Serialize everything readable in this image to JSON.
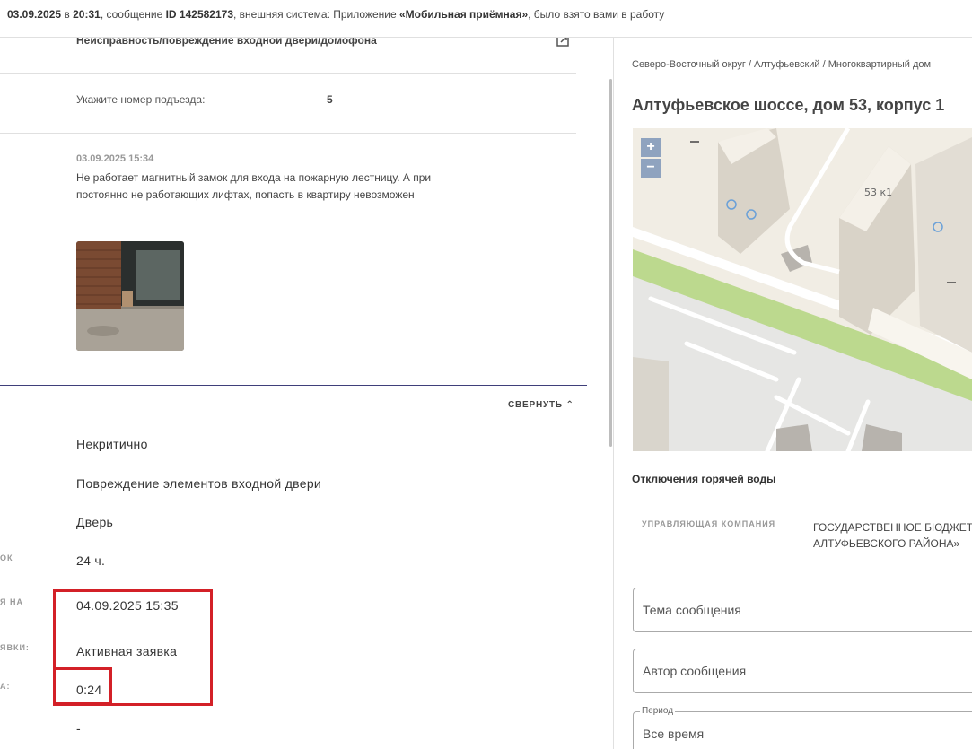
{
  "topbar": {
    "datetime_date": "03.09.2025",
    "in": " в ",
    "datetime_time": "20:31",
    "msg_prefix": ", сообщение ",
    "msg_id": "ID 142582173",
    "system_prefix": ", внешняя система: Приложение ",
    "system_name": "«Мобильная приёмная»",
    "suffix": ", было взято вами в работу"
  },
  "left": {
    "category_title": "Неисправность/повреждение входной двери/домофона",
    "entrance_label": "Укажите номер подъезда:",
    "entrance_value": "5",
    "comment_date": "03.09.2025 15:34",
    "comment_text": "Не работает магнитный замок для входа на пожарную лестницу. А при постоянно не работающих лифтах, попасть в квартиру невозможен",
    "collapse_label": "СВЕРНУТЬ",
    "clip_labels": {
      "deadline": "ОК",
      "date": "Я НА",
      "status": "ЯВКИ:",
      "timer": "А:"
    },
    "fields": {
      "criticality": "Некритично",
      "defect": "Повреждение элементов входной двери",
      "element": "Дверь",
      "term": "24 ч.",
      "due_date": "04.09.2025 15:35",
      "status": "Активная заявка",
      "timer": "0:24",
      "dash": "-"
    }
  },
  "right": {
    "breadcrumb": "Северо-Восточный округ / Алтуфьевский / Многоквартирный дом",
    "address": "Алтуфьевское шоссе, дом 53, корпус 1",
    "map": {
      "zoom_in": "+",
      "zoom_out": "−",
      "building_label": "53 к1"
    },
    "hot_water": "Отключения горячей воды",
    "uk_label": "УПРАВЛЯЮЩАЯ КОМПАНИЯ",
    "uk_value_line1": "ГОСУДАРСТВЕННОЕ БЮДЖЕТНОЕ",
    "uk_value_line2": "АЛТУФЬЕВСКОГО РАЙОНА»",
    "topic_placeholder": "Тема сообщения",
    "author_placeholder": "Автор сообщения",
    "period_label": "Период",
    "period_value": "Все время"
  },
  "colors": {
    "highlight": "#d32027",
    "divider": "#3f3f7a",
    "map_green": "#bcd98e",
    "zoom": "#8fa3bf"
  }
}
